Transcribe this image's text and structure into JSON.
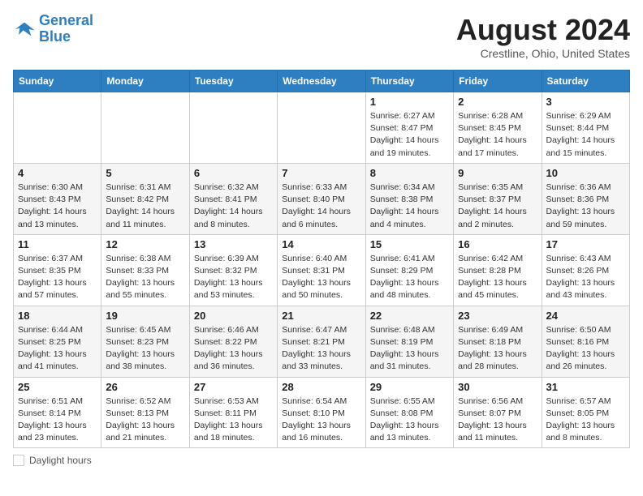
{
  "header": {
    "logo_line1": "General",
    "logo_line2": "Blue",
    "month_year": "August 2024",
    "location": "Crestline, Ohio, United States"
  },
  "weekdays": [
    "Sunday",
    "Monday",
    "Tuesday",
    "Wednesday",
    "Thursday",
    "Friday",
    "Saturday"
  ],
  "weeks": [
    [
      {
        "day": "",
        "info": ""
      },
      {
        "day": "",
        "info": ""
      },
      {
        "day": "",
        "info": ""
      },
      {
        "day": "",
        "info": ""
      },
      {
        "day": "1",
        "info": "Sunrise: 6:27 AM\nSunset: 8:47 PM\nDaylight: 14 hours\nand 19 minutes."
      },
      {
        "day": "2",
        "info": "Sunrise: 6:28 AM\nSunset: 8:45 PM\nDaylight: 14 hours\nand 17 minutes."
      },
      {
        "day": "3",
        "info": "Sunrise: 6:29 AM\nSunset: 8:44 PM\nDaylight: 14 hours\nand 15 minutes."
      }
    ],
    [
      {
        "day": "4",
        "info": "Sunrise: 6:30 AM\nSunset: 8:43 PM\nDaylight: 14 hours\nand 13 minutes."
      },
      {
        "day": "5",
        "info": "Sunrise: 6:31 AM\nSunset: 8:42 PM\nDaylight: 14 hours\nand 11 minutes."
      },
      {
        "day": "6",
        "info": "Sunrise: 6:32 AM\nSunset: 8:41 PM\nDaylight: 14 hours\nand 8 minutes."
      },
      {
        "day": "7",
        "info": "Sunrise: 6:33 AM\nSunset: 8:40 PM\nDaylight: 14 hours\nand 6 minutes."
      },
      {
        "day": "8",
        "info": "Sunrise: 6:34 AM\nSunset: 8:38 PM\nDaylight: 14 hours\nand 4 minutes."
      },
      {
        "day": "9",
        "info": "Sunrise: 6:35 AM\nSunset: 8:37 PM\nDaylight: 14 hours\nand 2 minutes."
      },
      {
        "day": "10",
        "info": "Sunrise: 6:36 AM\nSunset: 8:36 PM\nDaylight: 13 hours\nand 59 minutes."
      }
    ],
    [
      {
        "day": "11",
        "info": "Sunrise: 6:37 AM\nSunset: 8:35 PM\nDaylight: 13 hours\nand 57 minutes."
      },
      {
        "day": "12",
        "info": "Sunrise: 6:38 AM\nSunset: 8:33 PM\nDaylight: 13 hours\nand 55 minutes."
      },
      {
        "day": "13",
        "info": "Sunrise: 6:39 AM\nSunset: 8:32 PM\nDaylight: 13 hours\nand 53 minutes."
      },
      {
        "day": "14",
        "info": "Sunrise: 6:40 AM\nSunset: 8:31 PM\nDaylight: 13 hours\nand 50 minutes."
      },
      {
        "day": "15",
        "info": "Sunrise: 6:41 AM\nSunset: 8:29 PM\nDaylight: 13 hours\nand 48 minutes."
      },
      {
        "day": "16",
        "info": "Sunrise: 6:42 AM\nSunset: 8:28 PM\nDaylight: 13 hours\nand 45 minutes."
      },
      {
        "day": "17",
        "info": "Sunrise: 6:43 AM\nSunset: 8:26 PM\nDaylight: 13 hours\nand 43 minutes."
      }
    ],
    [
      {
        "day": "18",
        "info": "Sunrise: 6:44 AM\nSunset: 8:25 PM\nDaylight: 13 hours\nand 41 minutes."
      },
      {
        "day": "19",
        "info": "Sunrise: 6:45 AM\nSunset: 8:23 PM\nDaylight: 13 hours\nand 38 minutes."
      },
      {
        "day": "20",
        "info": "Sunrise: 6:46 AM\nSunset: 8:22 PM\nDaylight: 13 hours\nand 36 minutes."
      },
      {
        "day": "21",
        "info": "Sunrise: 6:47 AM\nSunset: 8:21 PM\nDaylight: 13 hours\nand 33 minutes."
      },
      {
        "day": "22",
        "info": "Sunrise: 6:48 AM\nSunset: 8:19 PM\nDaylight: 13 hours\nand 31 minutes."
      },
      {
        "day": "23",
        "info": "Sunrise: 6:49 AM\nSunset: 8:18 PM\nDaylight: 13 hours\nand 28 minutes."
      },
      {
        "day": "24",
        "info": "Sunrise: 6:50 AM\nSunset: 8:16 PM\nDaylight: 13 hours\nand 26 minutes."
      }
    ],
    [
      {
        "day": "25",
        "info": "Sunrise: 6:51 AM\nSunset: 8:14 PM\nDaylight: 13 hours\nand 23 minutes."
      },
      {
        "day": "26",
        "info": "Sunrise: 6:52 AM\nSunset: 8:13 PM\nDaylight: 13 hours\nand 21 minutes."
      },
      {
        "day": "27",
        "info": "Sunrise: 6:53 AM\nSunset: 8:11 PM\nDaylight: 13 hours\nand 18 minutes."
      },
      {
        "day": "28",
        "info": "Sunrise: 6:54 AM\nSunset: 8:10 PM\nDaylight: 13 hours\nand 16 minutes."
      },
      {
        "day": "29",
        "info": "Sunrise: 6:55 AM\nSunset: 8:08 PM\nDaylight: 13 hours\nand 13 minutes."
      },
      {
        "day": "30",
        "info": "Sunrise: 6:56 AM\nSunset: 8:07 PM\nDaylight: 13 hours\nand 11 minutes."
      },
      {
        "day": "31",
        "info": "Sunrise: 6:57 AM\nSunset: 8:05 PM\nDaylight: 13 hours\nand 8 minutes."
      }
    ]
  ],
  "footer": {
    "daylight_label": "Daylight hours"
  }
}
